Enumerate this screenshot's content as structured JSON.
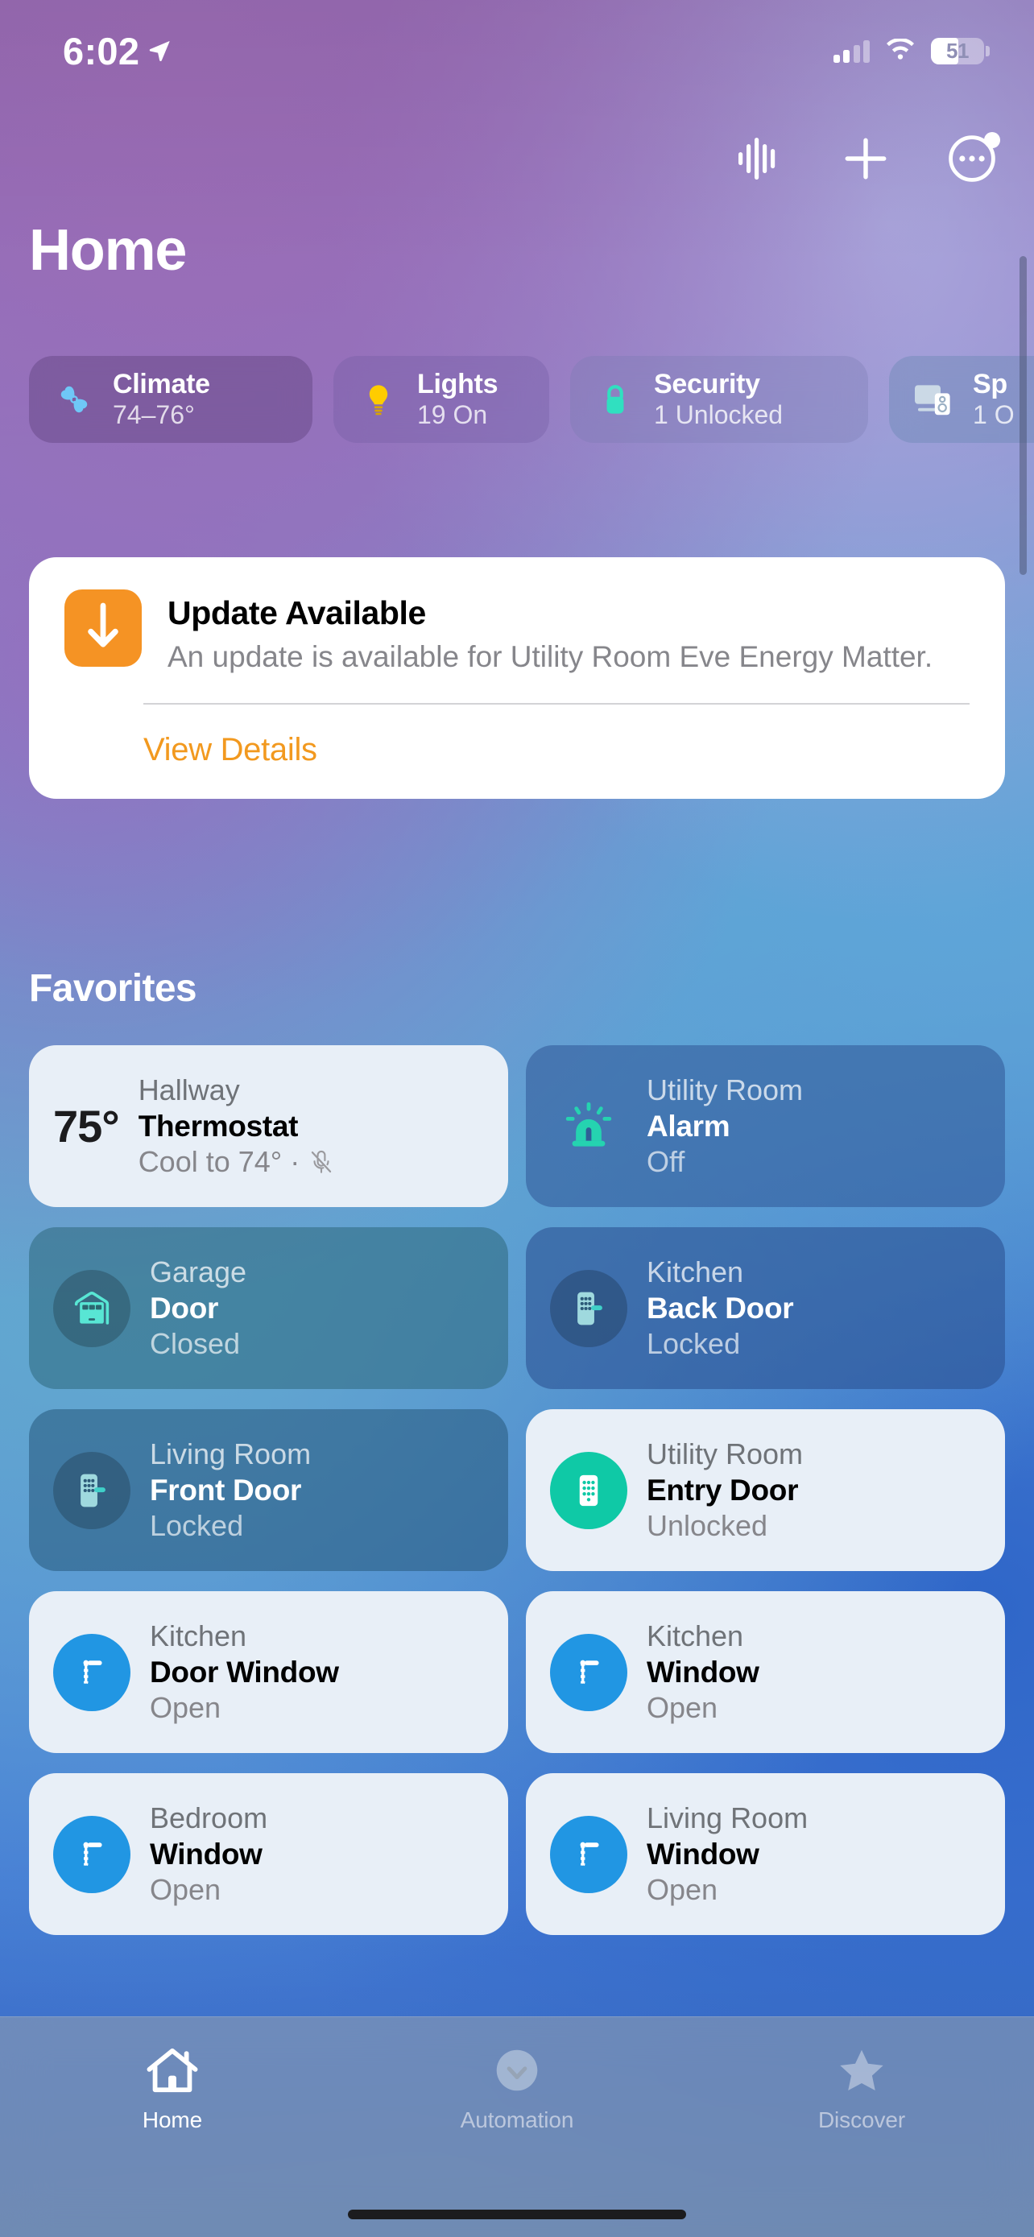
{
  "status_bar": {
    "time": "6:02",
    "location_icon": "location-arrow-icon",
    "cellular_icon": "cellular-bars-icon",
    "wifi_icon": "wifi-icon",
    "battery_percent": "51",
    "battery_icon": "battery-icon"
  },
  "nav": {
    "soundwave_label": "soundwave-icon",
    "add_label": "plus-icon",
    "more_label": "ellipsis-circle-icon"
  },
  "header": {
    "title": "Home"
  },
  "categories": [
    {
      "name": "Climate",
      "status": "74–76°",
      "icon": "fan-icon"
    },
    {
      "name": "Lights",
      "status": "19 On",
      "icon": "lightbulb-icon"
    },
    {
      "name": "Security",
      "status": "1 Unlocked",
      "icon": "lock-icon"
    },
    {
      "name": "Sp",
      "status": "1 O",
      "icon": "speaker-tv-icon"
    }
  ],
  "update_card": {
    "icon": "download-arrow-icon",
    "title": "Update Available",
    "description": "An update is available for Utility Room Eve Energy Matter.",
    "action_label": "View Details",
    "accent_color": "#F2991F"
  },
  "favorites": {
    "heading": "Favorites",
    "tiles": [
      {
        "room": "Hallway",
        "name": "Thermostat",
        "state": "Cool to 74° ·",
        "temperature": "75°",
        "icon": "thermostat-icon",
        "trailing_icon": "mic-off-icon",
        "theme": "light"
      },
      {
        "room": "Utility Room",
        "name": "Alarm",
        "state": "Off",
        "icon": "siren-icon",
        "theme": "dark"
      },
      {
        "room": "Garage",
        "name": "Door",
        "state": "Closed",
        "icon": "garage-door-icon",
        "theme": "dark"
      },
      {
        "room": "Kitchen",
        "name": "Back Door",
        "state": "Locked",
        "icon": "keypad-lock-icon",
        "theme": "dark"
      },
      {
        "room": "Living Room",
        "name": "Front Door",
        "state": "Locked",
        "icon": "keypad-lock-icon",
        "theme": "dark"
      },
      {
        "room": "Utility Room",
        "name": "Entry Door",
        "state": "Unlocked",
        "icon": "keypad-lock-icon",
        "theme": "light"
      },
      {
        "room": "Kitchen",
        "name": "Door Window",
        "state": "Open",
        "icon": "window-open-icon",
        "theme": "light"
      },
      {
        "room": "Kitchen",
        "name": "Window",
        "state": "Open",
        "icon": "window-open-icon",
        "theme": "light"
      },
      {
        "room": "Bedroom",
        "name": "Window",
        "state": "Open",
        "icon": "window-open-icon",
        "theme": "light"
      },
      {
        "room": "Living Room",
        "name": "Window",
        "state": "Open",
        "icon": "window-open-icon",
        "theme": "light"
      }
    ]
  },
  "tab_bar": [
    {
      "label": "Home",
      "icon": "house-icon",
      "active": true
    },
    {
      "label": "Automation",
      "icon": "automation-icon",
      "active": false
    },
    {
      "label": "Discover",
      "icon": "star-icon",
      "active": false
    }
  ]
}
